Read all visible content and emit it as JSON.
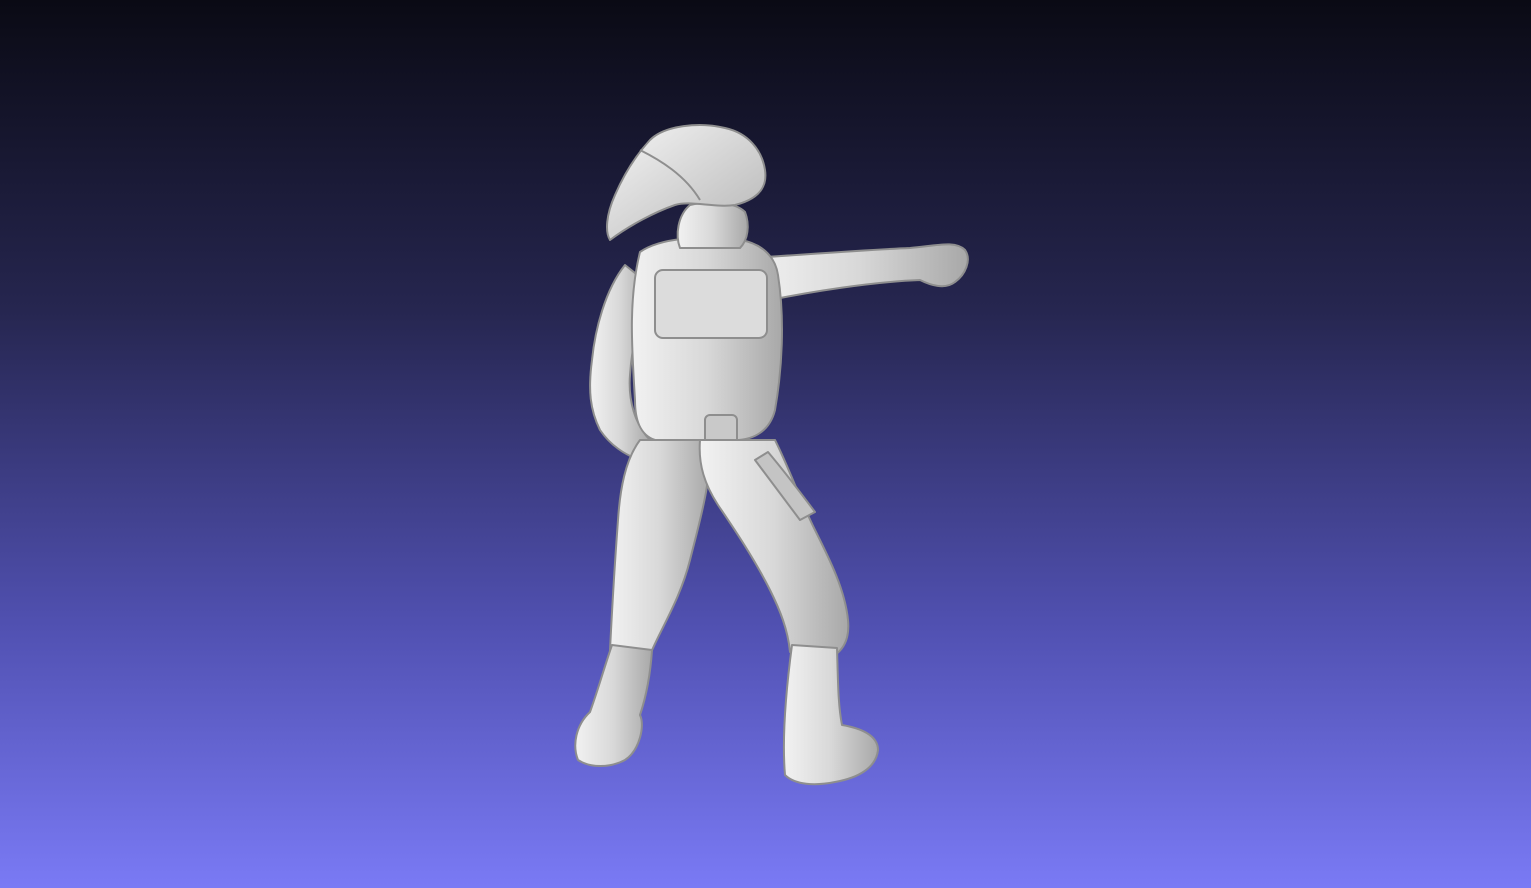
{
  "viewer": {
    "background": {
      "top_color": "#0a0a14",
      "bottom_color": "#7a7af5"
    },
    "model": {
      "subject": "soldier-figure-3d-scan",
      "surface_color": "#d8d8d8",
      "shading_color": "#8e8e8e"
    }
  }
}
